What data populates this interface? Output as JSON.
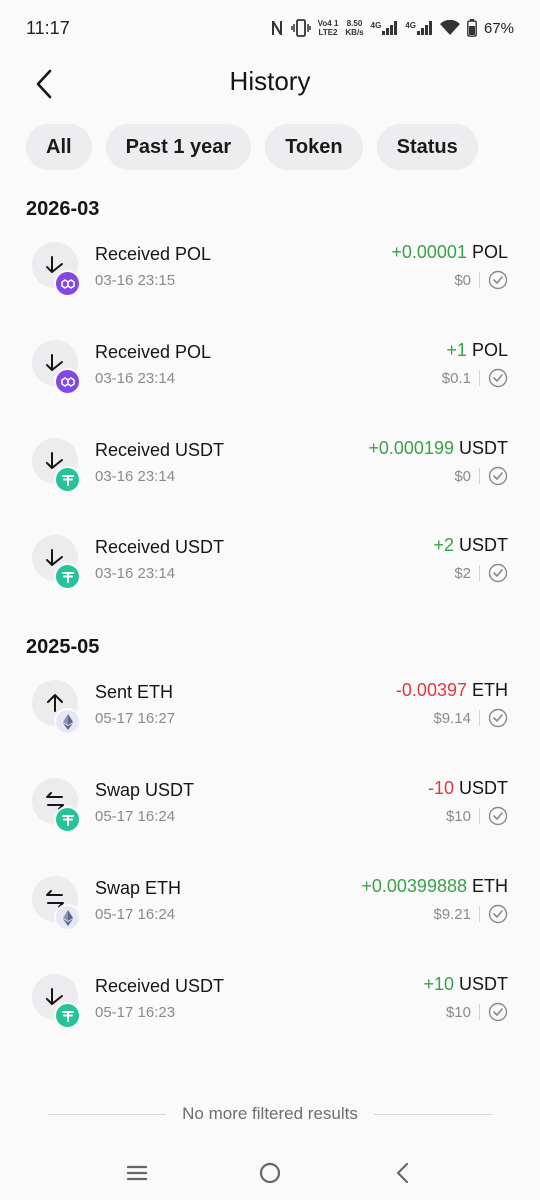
{
  "status_bar": {
    "time": "11:17",
    "volte": "Vo4 1",
    "lte": "LTE2",
    "speed": "8.50",
    "speed_unit": "KB/s",
    "net1": "4G",
    "net2": "4G",
    "battery": "67%"
  },
  "header": {
    "title": "History"
  },
  "filters": [
    "All",
    "Past 1 year",
    "Token",
    "Status"
  ],
  "sections": [
    {
      "title": "2026-03",
      "transactions": [
        {
          "title": "Received POL",
          "time": "03-16 23:15",
          "amount": "+0.00001",
          "symbol": "POL",
          "usd": "$0",
          "direction": "in",
          "token": "pol"
        },
        {
          "title": "Received POL",
          "time": "03-16 23:14",
          "amount": "+1",
          "symbol": "POL",
          "usd": "$0.1",
          "direction": "in",
          "token": "pol"
        },
        {
          "title": "Received USDT",
          "time": "03-16 23:14",
          "amount": "+0.000199",
          "symbol": "USDT",
          "usd": "$0",
          "direction": "in",
          "token": "usdt"
        },
        {
          "title": "Received USDT",
          "time": "03-16 23:14",
          "amount": "+2",
          "symbol": "USDT",
          "usd": "$2",
          "direction": "in",
          "token": "usdt"
        }
      ]
    },
    {
      "title": "2025-05",
      "transactions": [
        {
          "title": "Sent ETH",
          "time": "05-17 16:27",
          "amount": "-0.00397",
          "symbol": "ETH",
          "usd": "$9.14",
          "direction": "out",
          "token": "eth"
        },
        {
          "title": "Swap USDT",
          "time": "05-17 16:24",
          "amount": "-10",
          "symbol": "USDT",
          "usd": "$10",
          "direction": "swap",
          "token": "usdt"
        },
        {
          "title": "Swap ETH",
          "time": "05-17 16:24",
          "amount": "+0.00399888",
          "symbol": "ETH",
          "usd": "$9.21",
          "direction": "swap",
          "token": "eth"
        },
        {
          "title": "Received USDT",
          "time": "05-17 16:23",
          "amount": "+10",
          "symbol": "USDT",
          "usd": "$10",
          "direction": "in",
          "token": "usdt"
        }
      ]
    }
  ],
  "footer": {
    "message": "No more filtered results"
  },
  "colors": {
    "positive": "#3aa14a",
    "negative": "#e0393e",
    "pol": "#8247e5",
    "usdt": "#26c39a"
  }
}
